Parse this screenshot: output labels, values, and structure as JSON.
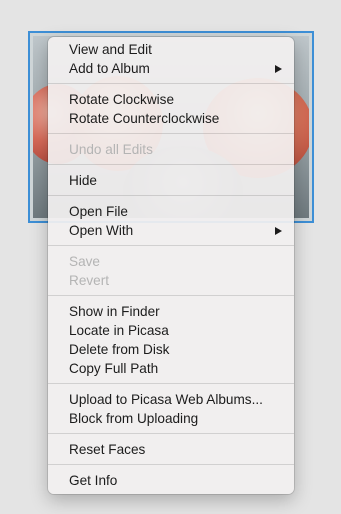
{
  "menu": {
    "groups": [
      [
        {
          "label": "View and Edit",
          "enabled": true
        },
        {
          "label": "Add to Album",
          "enabled": true,
          "submenu": true
        }
      ],
      [
        {
          "label": "Rotate Clockwise",
          "enabled": true
        },
        {
          "label": "Rotate Counterclockwise",
          "enabled": true
        }
      ],
      [
        {
          "label": "Undo all Edits",
          "enabled": false
        }
      ],
      [
        {
          "label": "Hide",
          "enabled": true
        }
      ],
      [
        {
          "label": "Open File",
          "enabled": true
        },
        {
          "label": "Open With",
          "enabled": true,
          "submenu": true
        }
      ],
      [
        {
          "label": "Save",
          "enabled": false
        },
        {
          "label": "Revert",
          "enabled": false
        }
      ],
      [
        {
          "label": "Show in Finder",
          "enabled": true
        },
        {
          "label": "Locate in Picasa",
          "enabled": true
        },
        {
          "label": "Delete from Disk",
          "enabled": true
        },
        {
          "label": "Copy Full Path",
          "enabled": true
        }
      ],
      [
        {
          "label": "Upload to Picasa Web Albums...",
          "enabled": true
        },
        {
          "label": "Block from Uploading",
          "enabled": true
        }
      ],
      [
        {
          "label": "Reset Faces",
          "enabled": true
        }
      ],
      [
        {
          "label": "Get Info",
          "enabled": true
        }
      ]
    ]
  },
  "colors": {
    "selection_border": "#3d8fd6",
    "text_enabled": "#1c1c1c",
    "text_disabled": "#b4b4b4"
  }
}
